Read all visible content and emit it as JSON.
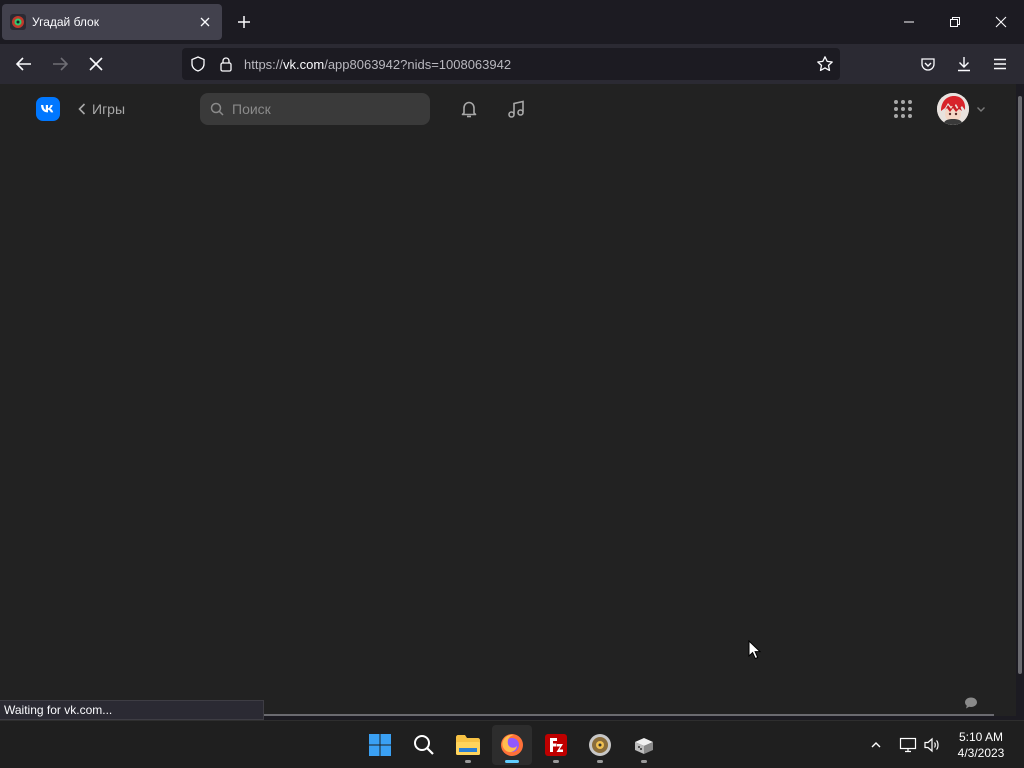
{
  "browser": {
    "tab": {
      "title": "Угадай блок"
    },
    "url": {
      "prefix": "https://",
      "host": "vk.com",
      "path": "/app8063942?nids=1008063942"
    },
    "status_text": "Waiting for vk.com..."
  },
  "vk": {
    "back_label": "Игры",
    "search_placeholder": "Поиск"
  },
  "taskbar": {
    "apps": [
      "start",
      "search",
      "file-explorer",
      "firefox",
      "filezilla",
      "media-player",
      "app"
    ],
    "clock": {
      "time": "5:10 AM",
      "date": "4/3/2023"
    }
  },
  "colors": {
    "vk_brand": "#0077ff",
    "page_bg": "#222222",
    "browser_bg": "#1c1b22",
    "accent": "#60cdff"
  }
}
